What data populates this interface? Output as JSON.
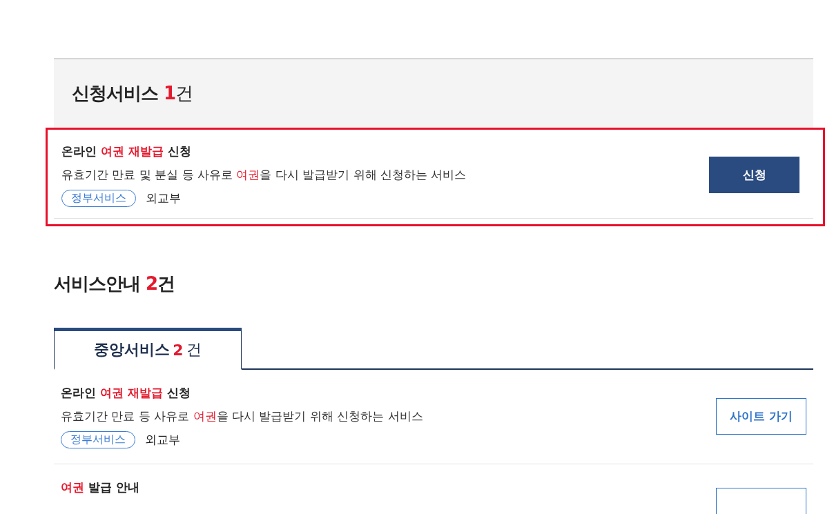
{
  "applied": {
    "title": "신청서비스",
    "count": "1",
    "unit": "건",
    "items": [
      {
        "title": [
          {
            "text": "온라인 ",
            "highlight": false
          },
          {
            "text": "여권 재발급",
            "highlight": true
          },
          {
            "text": " 신청",
            "highlight": false
          }
        ],
        "description": [
          {
            "text": "유효기간 만료 및 분실 등 사유로 ",
            "highlight": false
          },
          {
            "text": "여권",
            "highlight": true
          },
          {
            "text": "을 다시 발급받기 위해 신청하는 서비스",
            "highlight": false
          }
        ],
        "tag": "정부서비스",
        "agency": "외교부",
        "button": {
          "label": "신청",
          "kind": "primary"
        },
        "highlighted": true
      }
    ]
  },
  "guide": {
    "title": "서비스안내",
    "count": "2",
    "unit": "건",
    "tabs": [
      {
        "label": "중앙서비스",
        "count": "2",
        "unit": "건",
        "selected": true
      }
    ],
    "items": [
      {
        "title": [
          {
            "text": "온라인 ",
            "highlight": false
          },
          {
            "text": "여권 재발급",
            "highlight": true
          },
          {
            "text": " 신청",
            "highlight": false
          }
        ],
        "description": [
          {
            "text": "유효기간 만료 등 사유로 ",
            "highlight": false
          },
          {
            "text": "여권",
            "highlight": true
          },
          {
            "text": "을 다시 발급받기 위해 신청하는 서비스",
            "highlight": false
          }
        ],
        "tag": "정부서비스",
        "agency": "외교부",
        "button": {
          "label": "사이트 가기",
          "kind": "outline"
        }
      },
      {
        "title": [
          {
            "text": "여권",
            "highlight": true
          },
          {
            "text": " 발급 안내",
            "highlight": false
          }
        ],
        "button": {
          "kind": "outline"
        }
      }
    ]
  }
}
